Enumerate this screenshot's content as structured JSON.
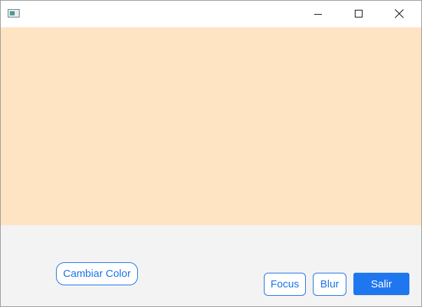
{
  "window": {
    "title": "",
    "controls": {
      "minimize": "minimize-icon",
      "maximize": "maximize-icon",
      "close": "close-icon"
    }
  },
  "content": {
    "background_color": "#ffe4c4"
  },
  "buttons": {
    "cambiar_color": "Cambiar Color",
    "focus": "Focus",
    "blur": "Blur",
    "salir": "Salir"
  },
  "colors": {
    "accent": "#1a73e8",
    "primary_button": "#1f77ef",
    "bottom_background": "#f3f3f3"
  }
}
